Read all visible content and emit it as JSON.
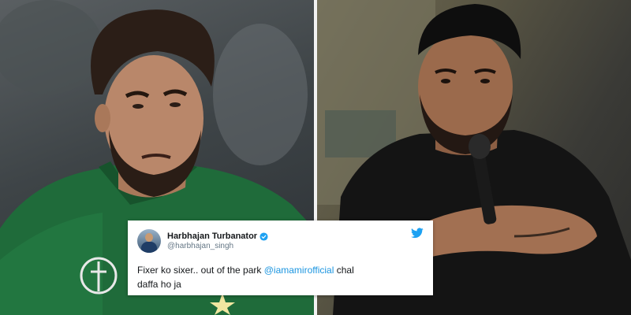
{
  "tweet": {
    "display_name": "Harbhajan Turbanator",
    "handle": "@harbhajan_singh",
    "text_before": "Fixer ko sixer.. out of the park ",
    "mention": "@iamamirofficial",
    "text_after": " chal daffa ho ja",
    "accent_color": "#1da1f2",
    "verified": true
  },
  "photos": {
    "left": {
      "icon": "cricket-player-photo",
      "jersey_color": "#1f6b3a"
    },
    "right": {
      "icon": "speaker-photo",
      "shirt_color": "#141414"
    }
  }
}
